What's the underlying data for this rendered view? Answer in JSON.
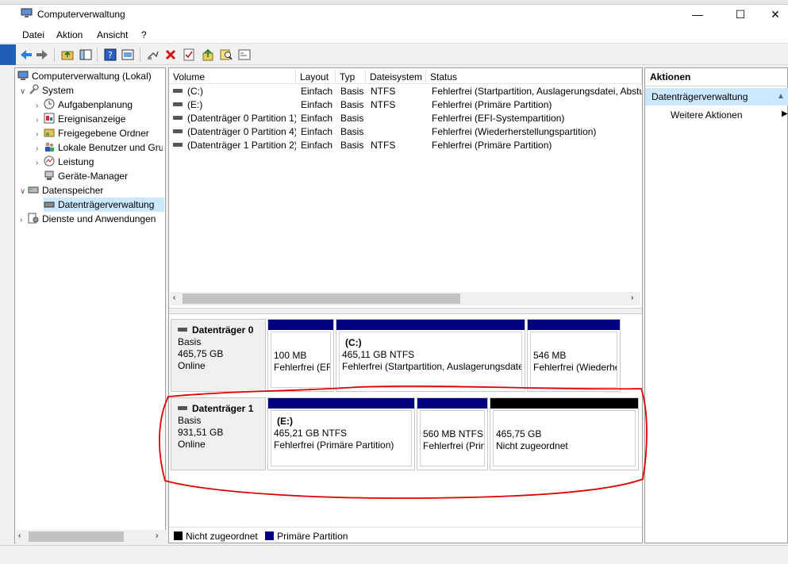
{
  "window": {
    "title": "Computerverwaltung",
    "buttons": [
      "—",
      "☐",
      "✕"
    ]
  },
  "menu": [
    "Datei",
    "Aktion",
    "Ansicht",
    "?"
  ],
  "toolbar_icons": [
    "back-icon",
    "forward-icon",
    "up-folder-icon",
    "show-hide-tree-icon",
    "help-icon",
    "properties-icon",
    "connect-icon",
    "delete-icon",
    "checkmark-icon",
    "import-icon",
    "search-icon",
    "view-icon"
  ],
  "tree": {
    "root": "Computerverwaltung (Lokal)",
    "system": "System",
    "aufgabenplanung": "Aufgabenplanung",
    "ereignisanzeige": "Ereignisanzeige",
    "freigegebene": "Freigegebene Ordner",
    "lokale": "Lokale Benutzer und Gruppen",
    "leistung": "Leistung",
    "geraete": "Geräte-Manager",
    "datenspeicher": "Datenspeicher",
    "datentraeger": "Datenträgerverwaltung",
    "dienste": "Dienste und Anwendungen"
  },
  "table": {
    "headers": [
      "Volume",
      "Layout",
      "Typ",
      "Dateisystem",
      "Status"
    ],
    "rows": [
      {
        "volume": "(C:)",
        "layout": "Einfach",
        "typ": "Basis",
        "fs": "NTFS",
        "status": "Fehlerfrei (Startpartition, Auslagerungsdatei, Absturzabbild)"
      },
      {
        "volume": "(E:)",
        "layout": "Einfach",
        "typ": "Basis",
        "fs": "NTFS",
        "status": "Fehlerfrei (Primäre Partition)"
      },
      {
        "volume": "(Datenträger 0 Partition 1)",
        "layout": "Einfach",
        "typ": "Basis",
        "fs": "",
        "status": "Fehlerfrei (EFI-Systempartition)"
      },
      {
        "volume": "(Datenträger 0 Partition 4)",
        "layout": "Einfach",
        "typ": "Basis",
        "fs": "",
        "status": "Fehlerfrei (Wiederherstellungspartition)"
      },
      {
        "volume": "(Datenträger 1 Partition 2)",
        "layout": "Einfach",
        "typ": "Basis",
        "fs": "NTFS",
        "status": "Fehlerfrei (Primäre Partition)"
      }
    ]
  },
  "disks": {
    "d0": {
      "name": "Datenträger 0",
      "type": "Basis",
      "size": "465,75 GB",
      "state": "Online",
      "p1": {
        "label": "",
        "size": "100 MB",
        "status": "Fehlerfrei (EFI-Systempartition)"
      },
      "p2": {
        "label": "(C:)",
        "size": "465,11 GB NTFS",
        "status": "Fehlerfrei (Startpartition, Auslagerungsdatei, Absturzabbild)"
      },
      "p3": {
        "label": "",
        "size": "546 MB",
        "status": "Fehlerfrei (Wiederherstellungspartition)"
      }
    },
    "d1": {
      "name": "Datenträger 1",
      "type": "Basis",
      "size": "931,51 GB",
      "state": "Online",
      "p1": {
        "label": "(E:)",
        "size": "465,21 GB NTFS",
        "status": "Fehlerfrei (Primäre Partition)"
      },
      "p2": {
        "label": "",
        "size": "560 MB NTFS",
        "status": "Fehlerfrei (Primäre Partition)"
      },
      "p3": {
        "label": "",
        "size": "465,75 GB",
        "status": "Nicht zugeordnet"
      }
    }
  },
  "legend": {
    "unallocated": "Nicht zugeordnet",
    "primary": "Primäre Partition"
  },
  "actions": {
    "title": "Aktionen",
    "section": "Datenträgerverwaltung",
    "more": "Weitere Aktionen"
  },
  "colors": {
    "primary_bar": "#000080",
    "unallocated_bar": "#000000",
    "annotation": "#e00000",
    "selection": "#cce8ff"
  }
}
